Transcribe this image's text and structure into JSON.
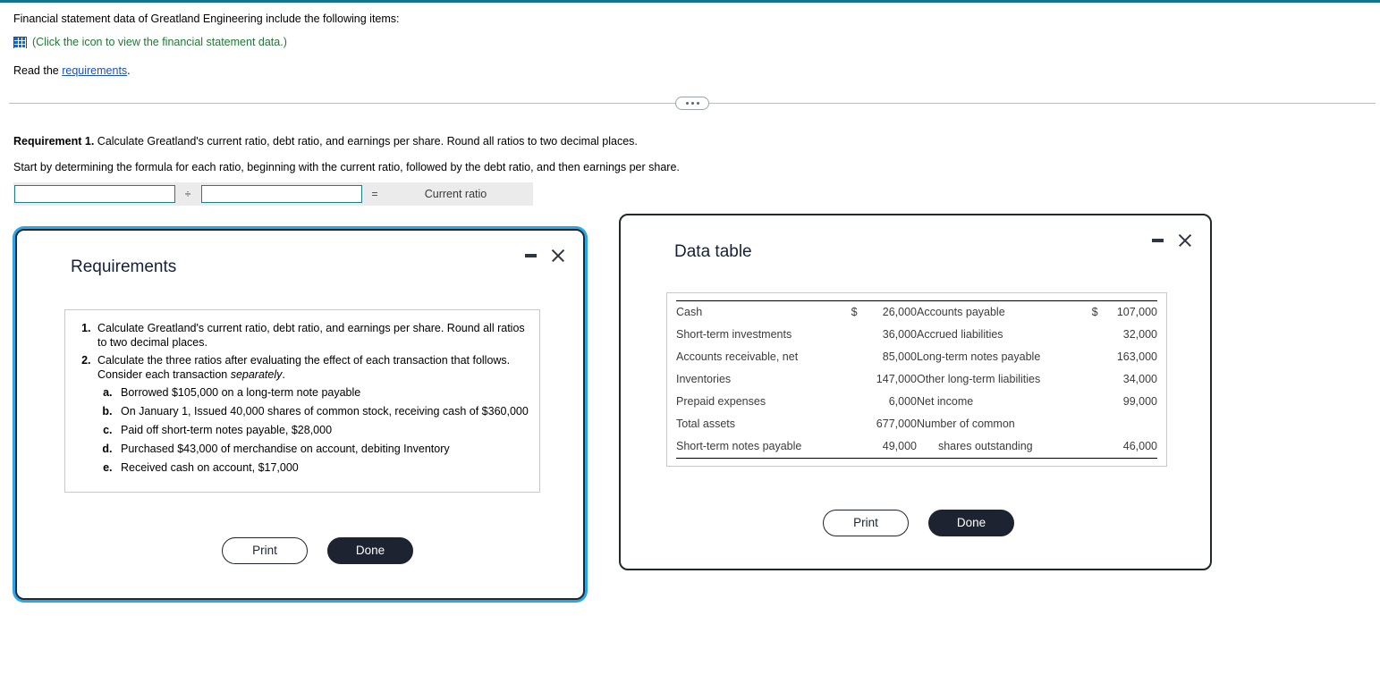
{
  "problem": {
    "intro": "Financial statement data of Greatland Engineering include the following items:",
    "icon_name": "table-grid-icon",
    "icon_link_text": "(Click the icon to view the financial statement data.)",
    "read_prefix": "Read the ",
    "read_link": "requirements",
    "read_suffix": "."
  },
  "requirement1": {
    "label": "Requirement 1.",
    "text": " Calculate Greatland's current ratio, debt ratio, and earnings per share. Round all ratios to two decimal places.",
    "instruction": "Start by determining the formula for each ratio, beginning with the current ratio, followed by the debt ratio, and then earnings per share."
  },
  "formula_row": {
    "numerator_value": "",
    "numerator_placeholder": "",
    "divide_symbol": "÷",
    "denominator_value": "",
    "denominator_placeholder": "",
    "equals_symbol": "=",
    "result_label": "Current ratio"
  },
  "requirements_modal": {
    "title": "Requirements",
    "minimize_icon": "minimize-icon",
    "close_icon": "close-icon",
    "items": [
      {
        "text": "Calculate Greatland's current ratio, debt ratio, and earnings per share. Round all ratios to two decimal places.",
        "subitems": []
      },
      {
        "text_before_italic": "Calculate the three ratios after evaluating the effect of each transaction that follows. Consider each transaction ",
        "italic_word": "separately",
        "text_after_italic": ".",
        "subitems": [
          "Borrowed $105,000 on a long-term note payable",
          "On January 1, Issued 40,000 shares of common stock, receiving cash of $360,000",
          "Paid off short-term notes payable, $28,000",
          "Purchased $43,000 of merchandise on account, debiting Inventory",
          "Received cash on account, $17,000"
        ]
      }
    ],
    "print_label": "Print",
    "done_label": "Done"
  },
  "data_modal": {
    "title": "Data table",
    "minimize_icon": "minimize-icon",
    "close_icon": "close-icon",
    "print_label": "Print",
    "done_label": "Done",
    "rows": [
      {
        "left_label": "Cash",
        "left_currency": "$",
        "left_value": "26,000",
        "right_label": "Accounts payable",
        "right_currency": "$",
        "right_value": "107,000",
        "right_indent": false
      },
      {
        "left_label": "Short-term investments",
        "left_currency": "",
        "left_value": "36,000",
        "right_label": "Accrued liabilities",
        "right_currency": "",
        "right_value": "32,000",
        "right_indent": false
      },
      {
        "left_label": "Accounts receivable, net",
        "left_currency": "",
        "left_value": "85,000",
        "right_label": "Long-term notes payable",
        "right_currency": "",
        "right_value": "163,000",
        "right_indent": false
      },
      {
        "left_label": "Inventories",
        "left_currency": "",
        "left_value": "147,000",
        "right_label": "Other long-term liabilities",
        "right_currency": "",
        "right_value": "34,000",
        "right_indent": false
      },
      {
        "left_label": "Prepaid expenses",
        "left_currency": "",
        "left_value": "6,000",
        "right_label": "Net income",
        "right_currency": "",
        "right_value": "99,000",
        "right_indent": false
      },
      {
        "left_label": "Total assets",
        "left_currency": "",
        "left_value": "677,000",
        "right_label": "Number of common",
        "right_currency": "",
        "right_value": "",
        "right_indent": false
      },
      {
        "left_label": "Short-term notes payable",
        "left_currency": "",
        "left_value": "49,000",
        "right_label": "shares outstanding",
        "right_currency": "",
        "right_value": "46,000",
        "right_indent": true
      }
    ]
  },
  "colors": {
    "accent_top_border": "#12738f",
    "green_link": "#1d7a32",
    "blue_link": "#1a4fc4",
    "focus_ring": "#2ba6e8",
    "modal_border": "#23282e",
    "button_solid": "#1d2330",
    "input_border": "#1c7b96",
    "formula_bg": "#ebebeb"
  }
}
